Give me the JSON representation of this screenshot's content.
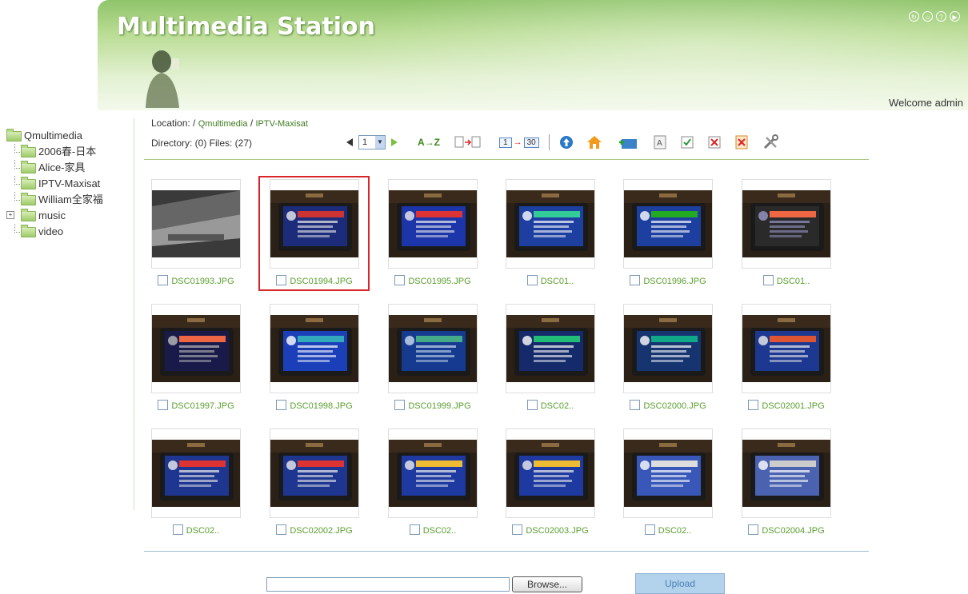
{
  "header": {
    "title": "Multimedia Station",
    "welcome": "Welcome admin"
  },
  "tree": {
    "root": "Qmultimedia",
    "items": [
      {
        "label": "2006春-日本",
        "expandable": false
      },
      {
        "label": "Alice-家具",
        "expandable": false
      },
      {
        "label": "IPTV-Maxisat",
        "expandable": false
      },
      {
        "label": "William全家福",
        "expandable": false
      },
      {
        "label": "music",
        "expandable": true
      },
      {
        "label": "video",
        "expandable": false
      }
    ]
  },
  "location": {
    "label": "Location: /",
    "path1": "Qmultimedia",
    "sep": "/",
    "path2": "IPTV-Maxisat"
  },
  "counts": {
    "text": "Directory: (0) Files: (27)"
  },
  "pager": {
    "selected_page": "1"
  },
  "toolbar": {
    "sort_az": "A→Z",
    "range_from": "1",
    "range_to": "30"
  },
  "files": [
    "DSC01993.JPG",
    "DSC01994.JPG",
    "DSC01995.JPG",
    "DSC01..",
    "DSC01996.JPG",
    "DSC01..",
    "DSC01997.JPG",
    "DSC01998.JPG",
    "DSC01999.JPG",
    "DSC02..",
    "DSC02000.JPG",
    "DSC02001.JPG",
    "DSC02..",
    "DSC02002.JPG",
    "DSC02..",
    "DSC02003.JPG",
    "DSC02..",
    "DSC02004.JPG"
  ],
  "selected_file_index": 1,
  "upload": {
    "browse_label": "Browse...",
    "upload_label": "Upload"
  },
  "colors": {
    "accent_green": "#5a9e2f",
    "selection_red": "#d9252a"
  }
}
